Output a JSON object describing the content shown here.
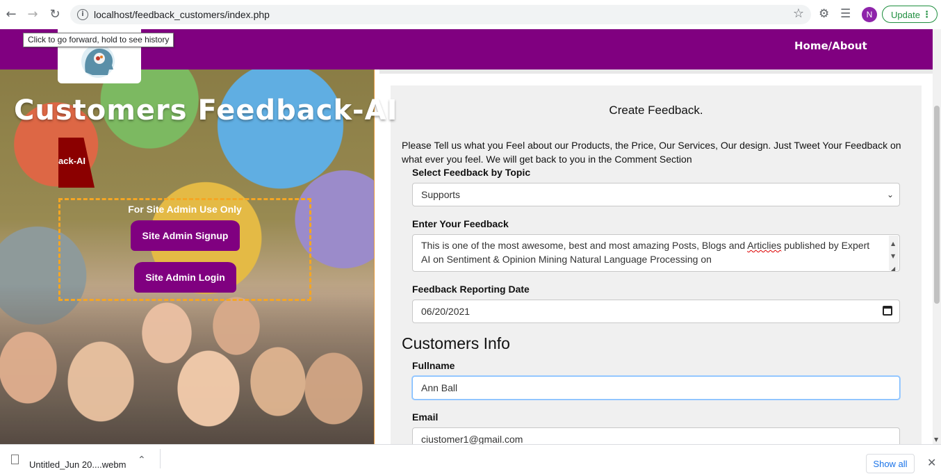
{
  "browser": {
    "url": "localhost/feedback_customers/index.php",
    "tooltip": "Click to go forward, hold to see history",
    "avatar_letter": "N",
    "update_label": "Update"
  },
  "header": {
    "nav_label": "Home/About",
    "brand_color": "#800080"
  },
  "hero": {
    "title": "Customers Feedback-AI",
    "slide_tag": "ack-AI",
    "admin_box_title": "For Site Admin Use Only",
    "signup_label": "Site Admin Signup",
    "login_label": "Site Admin Login"
  },
  "form": {
    "title": "Create Feedback.",
    "description": "Please Tell us what you Feel about our Products, the Price, Our Services, Our design. Just Tweet Your Feedback on what ever you feel. We will get back to you in the Comment Section",
    "topic_label": "Select Feedback by Topic",
    "topic_value": "Supports",
    "feedback_label": "Enter Your Feedback",
    "feedback_text_a": "This is one of the most awesome, best and most amazing Posts, Blogs and ",
    "feedback_text_misspelled": "Articlies",
    "feedback_text_b": " published by Expert AI on Sentiment & Opinion Mining Natural Language Processing on",
    "date_label": "Feedback Reporting Date",
    "date_value": "06/20/2021",
    "section_customers": "Customers Info",
    "fullname_label": "Fullname",
    "fullname_value": "Ann Ball",
    "email_label": "Email",
    "email_value": "ciustomer1@gmail.com"
  },
  "downloads": {
    "file_name": "Untitled_Jun 20....webm",
    "show_all_label": "Show all"
  }
}
